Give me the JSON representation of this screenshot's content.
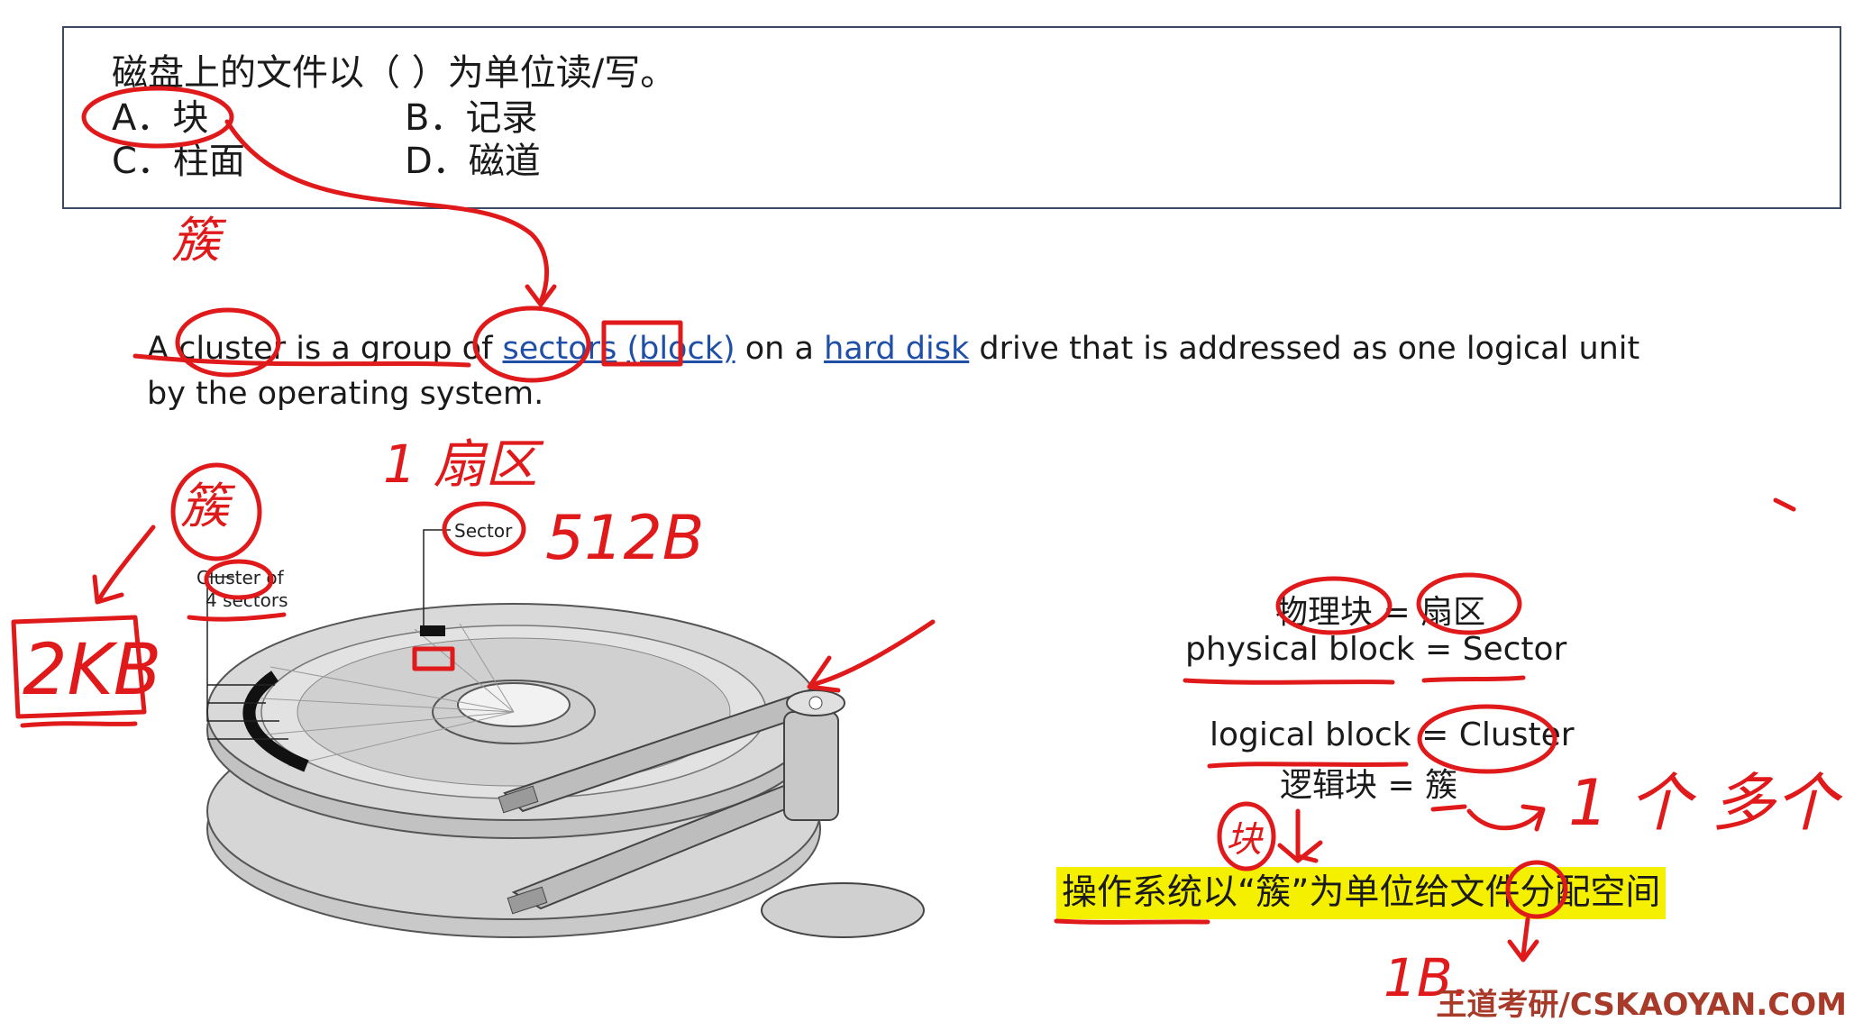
{
  "question": {
    "stem": "磁盘上的文件以（   ）为单位读/写。",
    "options": [
      {
        "text": "A．块"
      },
      {
        "text": "B．记录"
      },
      {
        "text": "C．柱面"
      },
      {
        "text": "D．磁道"
      }
    ]
  },
  "definition": {
    "prefix": "A ",
    "cluster": "cluster",
    "mid1": " is a group of ",
    "sectors": "sectors",
    "mid2": " ",
    "block": "(block)",
    "mid3": " on a ",
    "hard_disk": "hard disk",
    "suffix": " drive that is addressed as one logical unit by the operating system."
  },
  "diagram": {
    "sector_label": "Sector",
    "cluster_label_line1": "Cluster of",
    "cluster_label_line2": "4 sectors"
  },
  "equivalences": [
    {
      "left": "物理块",
      "eq": " = ",
      "right": "扇区"
    },
    {
      "left": "physical block",
      "eq": " = ",
      "right": "Sector"
    },
    {
      "left": "logical block",
      "eq": " = ",
      "right": "Cluster"
    },
    {
      "left": "逻辑块",
      "eq": " = ",
      "right": "簇"
    }
  ],
  "highlight_sentence": "操作系统以“簇”为单位给文件分配空间",
  "annotations": {
    "cu_top": "簇",
    "cu_left": "簇",
    "sector_zh": "1 扇区",
    "size_512": "512B",
    "size_2kb": "2KB",
    "kuai": "块",
    "one_to_many": "1 个 多个",
    "one_b": "1B."
  },
  "watermark": "王道考研/CSKAOYAN.COM",
  "colors": {
    "ink": "#e0191b",
    "highlight": "#f4f000",
    "link": "#1f4fa6",
    "box_border": "#3a4a66"
  }
}
